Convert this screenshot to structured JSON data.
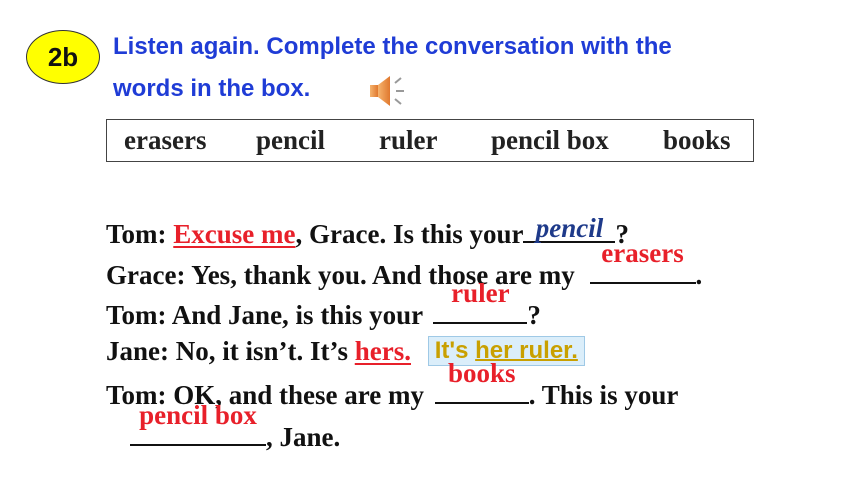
{
  "badge": "2b",
  "instructions": {
    "line1": "Listen again. Complete the conversation with the",
    "line2": "words in the box."
  },
  "word_box": [
    "erasers",
    "pencil",
    "ruler",
    "pencil box",
    "books"
  ],
  "conversation": {
    "l1": {
      "speaker": "Tom:",
      "answer1": "Excuse me",
      "mid": ", Grace. Is this your",
      "answer2": "pencil",
      "end": "?"
    },
    "l2": {
      "text": "Grace: Yes, thank you. And those are my",
      "answer": "erasers",
      "end": "."
    },
    "l3": {
      "text": "Tom: And Jane, is this your",
      "answer": "ruler",
      "end": "?"
    },
    "l4": {
      "text": "Jane: No, it isn’t. It’s",
      "answer": "hers.",
      "hint_pre": "It's ",
      "hint_hl": "her ruler."
    },
    "l5": {
      "text": "Tom: OK, and these are my",
      "answer": "books",
      "end": ". This is your"
    },
    "l6": {
      "answer": "pencil box",
      "end": ", Jane."
    }
  },
  "colors": {
    "answer": "#e8202a",
    "instruction": "#1f3cd6",
    "badge": "#ffff00",
    "hint_bg": "#dbeefa"
  }
}
